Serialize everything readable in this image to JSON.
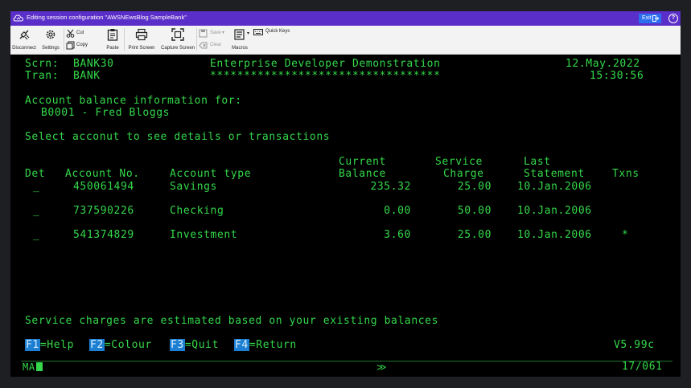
{
  "window": {
    "title": "Editing session configuration \"AWSNEwsBlog SampleBank\"",
    "exit_label": "Exit",
    "help_label": "?"
  },
  "toolbar": {
    "disconnect": "Disconnect",
    "settings": "Settings",
    "cut": "Cut",
    "copy": "Copy",
    "paste": "Paste",
    "print_screen": "Print Screen",
    "capture_screen": "Capture Screen",
    "save": "Save",
    "clear": "Clear",
    "macros": "Macros",
    "quick_keys": "Quick Keys"
  },
  "terminal": {
    "scrn_label": "Scrn:",
    "scrn_value": "BANK30",
    "tran_label": "Tran:",
    "tran_value": "BANK",
    "heading": "Enterprise Developer Demonstration",
    "stars": "**********************************",
    "date": "12.May.2022",
    "time": "15:30:56",
    "info_title": "Account balance information for:",
    "customer": "B0001 - Fred Bloggs",
    "instruction": "Select acconut to see details or transactions",
    "columns": {
      "current": "Current",
      "service": "Service",
      "last": "Last",
      "det": "Det",
      "account_no": "Account No.",
      "account_type": "Account type",
      "balance": "Balance",
      "charge": "Charge",
      "statement": "Statement",
      "txns": "Txns"
    },
    "rows": [
      {
        "sel": "_",
        "account_no": "450061494",
        "type": "Savings",
        "balance": "235.32",
        "charge": "25.00",
        "statement": "10.Jan.2006",
        "txns": ""
      },
      {
        "sel": "_",
        "account_no": "737590226",
        "type": "Checking",
        "balance": "0.00",
        "charge": "50.00",
        "statement": "10.Jan.2006",
        "txns": ""
      },
      {
        "sel": "_",
        "account_no": "541374829",
        "type": "Investment",
        "balance": "3.60",
        "charge": "25.00",
        "statement": "10.Jan.2006",
        "txns": "*"
      }
    ],
    "message": "Service charges are estimated based on your existing balances",
    "fkeys": [
      {
        "key": "F1",
        "label": "=Help"
      },
      {
        "key": "F2",
        "label": "=Colour"
      },
      {
        "key": "F3",
        "label": "=Quit"
      },
      {
        "key": "F4",
        "label": "=Return"
      }
    ],
    "version": "V5.99c",
    "status_left": "MA",
    "status_mid": "≫",
    "status_right": "17/061"
  },
  "colors": {
    "title_bar": "#5a2ec8",
    "terminal_text": "#34d84a",
    "fkey_bg": "#1c7fd1"
  }
}
